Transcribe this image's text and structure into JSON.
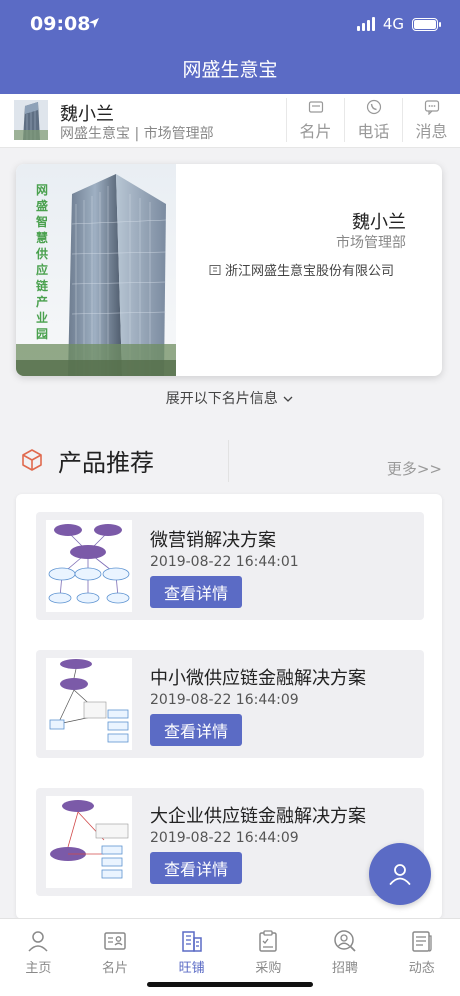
{
  "status": {
    "time": "09:08",
    "network": "4G"
  },
  "nav": {
    "title": "网盛生意宝"
  },
  "profile": {
    "name": "魏小兰",
    "subtitle": "网盛生意宝 | 市场管理部",
    "actions": [
      {
        "label": "名片",
        "icon": "card-icon"
      },
      {
        "label": "电话",
        "icon": "phone-icon"
      },
      {
        "label": "消息",
        "icon": "message-icon"
      }
    ]
  },
  "card": {
    "name": "魏小兰",
    "department": "市场管理部",
    "company": "浙江网盛生意宝股份有限公司",
    "photo_caption": "网盛智慧供应链产业园"
  },
  "expand": {
    "label": "展开以下名片信息"
  },
  "products_section": {
    "title": "产品推荐",
    "more": "更多>>"
  },
  "products": [
    {
      "title": "微营销解决方案",
      "time": "2019-08-22 16:44:01",
      "button": "查看详情"
    },
    {
      "title": "中小微供应链金融解决方案",
      "time": "2019-08-22 16:44:09",
      "button": "查看详情"
    },
    {
      "title": "大企业供应链金融解决方案",
      "time": "2019-08-22 16:44:09",
      "button": "查看详情"
    }
  ],
  "tabs": [
    {
      "label": "主页",
      "icon": "person-icon"
    },
    {
      "label": "名片",
      "icon": "namecard-icon"
    },
    {
      "label": "旺铺",
      "icon": "building-icon",
      "active": true
    },
    {
      "label": "采购",
      "icon": "clipboard-icon"
    },
    {
      "label": "招聘",
      "icon": "search-person-icon"
    },
    {
      "label": "动态",
      "icon": "news-icon"
    }
  ],
  "colors": {
    "primary": "#5b6bc5",
    "background": "#f2f2f4"
  }
}
